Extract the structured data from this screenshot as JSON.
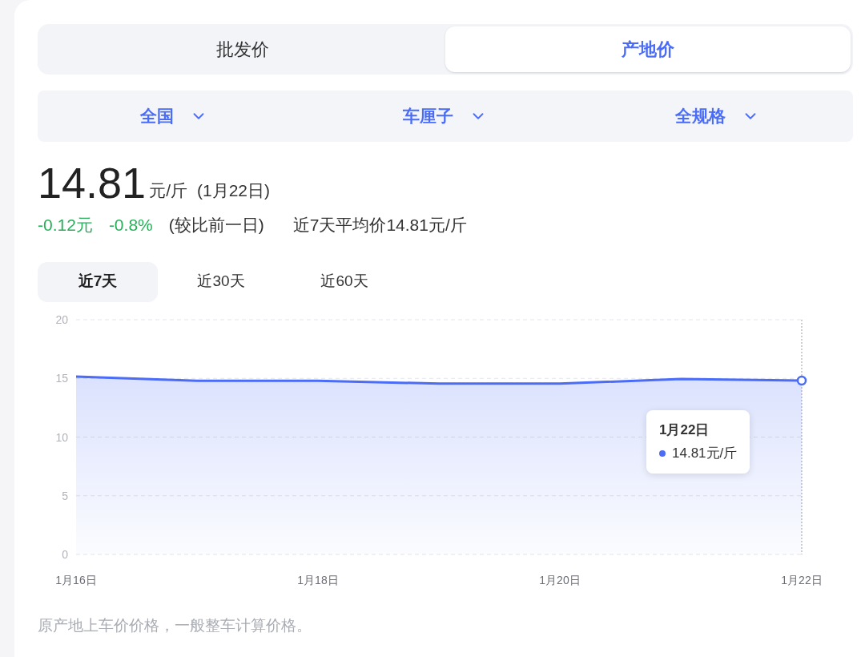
{
  "price_type_tabs": [
    {
      "label": "批发价",
      "selected": false
    },
    {
      "label": "产地价",
      "selected": true
    }
  ],
  "filters": [
    {
      "label": "全国"
    },
    {
      "label": "车厘子"
    },
    {
      "label": "全规格"
    }
  ],
  "price": {
    "value": "14.81",
    "unit": "元/斤",
    "date": "(1月22日)",
    "change": "-0.12元",
    "change_percent": "-0.8%",
    "change_note": "(较比前一日)",
    "average": "近7天平均价14.81元/斤"
  },
  "range_tabs": [
    {
      "label": "近7天",
      "selected": true
    },
    {
      "label": "近30天",
      "selected": false
    },
    {
      "label": "近60天",
      "selected": false
    }
  ],
  "chart": {
    "chart_data": {
      "type": "area",
      "categories": [
        "1月16日",
        null,
        "1月18日",
        null,
        "1月20日",
        null,
        "1月22日"
      ],
      "series": [
        {
          "color": "#4a6cf7",
          "values": [
            15.15,
            14.8,
            14.8,
            14.55,
            14.55,
            14.95,
            14.81
          ]
        }
      ],
      "ylim": [
        0,
        20
      ],
      "yticks": [
        0,
        5,
        10,
        15,
        20
      ],
      "grid": true
    },
    "tooltip": {
      "title": "1月22日",
      "value": "14.81元/斤"
    }
  },
  "footnote": "原产地上车价价格，一般整车计算价格。"
}
